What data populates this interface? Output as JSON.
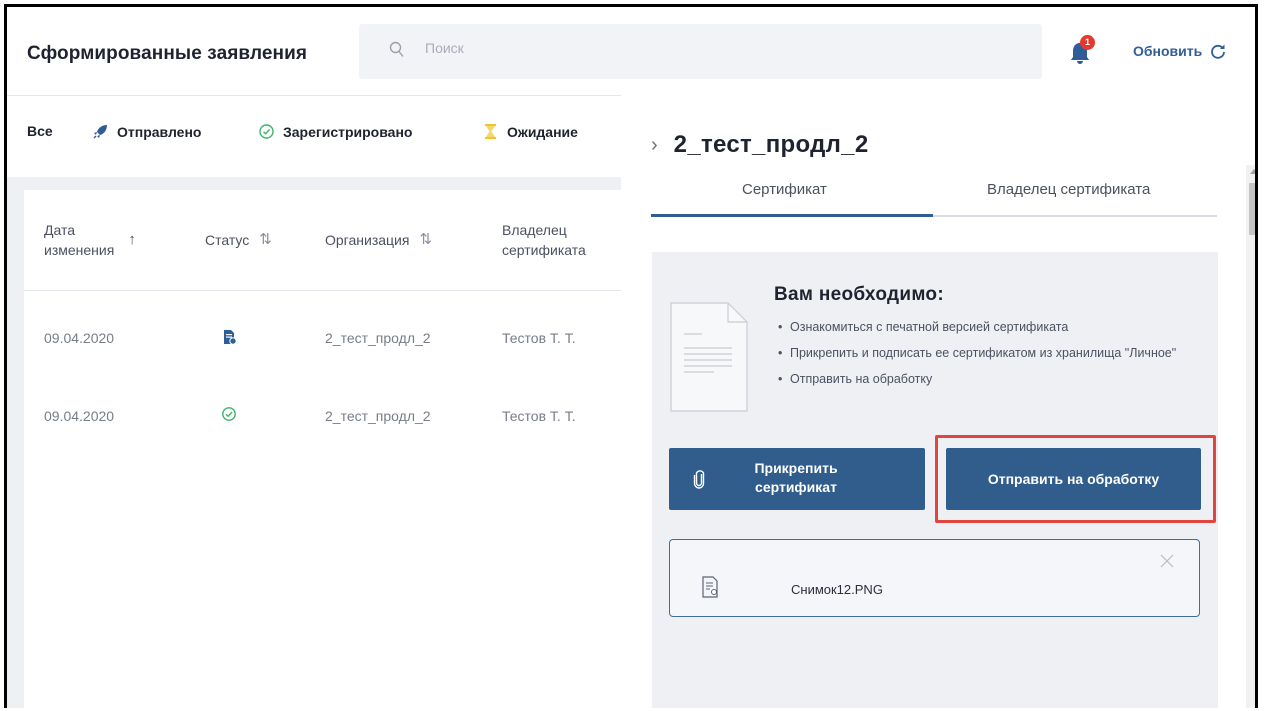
{
  "header": {
    "title": "Сформированные заявления",
    "search_placeholder": "Поиск",
    "notification_count": "1",
    "refresh_label": "Обновить"
  },
  "filters": {
    "all": "Все",
    "sent": "Отправлено",
    "registered": "Зарегистрировано",
    "waiting": "Ожидание"
  },
  "table": {
    "columns": {
      "date_line1": "Дата",
      "date_line2": "изменения",
      "status": "Статус",
      "organization": "Организация",
      "owner_line1": "Владелец",
      "owner_line2": "сертификата"
    },
    "rows": [
      {
        "date": "09.04.2020",
        "status": "sent",
        "organization": "2_тест_продл_2",
        "owner": "Тестов Т. Т."
      },
      {
        "date": "09.04.2020",
        "status": "registered",
        "organization": "2_тест_продл_2",
        "owner": "Тестов Т. Т."
      }
    ]
  },
  "detail": {
    "title": "2_тест_продл_2",
    "tabs": [
      "Сертификат",
      "Владелец сертификата"
    ],
    "active_tab": 0,
    "heading": "Вам необходимо:",
    "bullets": [
      "Ознакомиться с печатной версией сертификата",
      "Прикрепить и подписать ее сертификатом из хранилища \"Личное\"",
      "Отправить на обработку"
    ],
    "attach_button": "Прикрепить сертификат",
    "send_button": "Отправить на обработку",
    "file_name": "Снимок12.PNG"
  },
  "colors": {
    "primary": "#305d8c",
    "link": "#2f5e97",
    "highlight": "#e0463f",
    "badge": "#e23a2f",
    "waiting_icon": "#f2c230",
    "registered_icon": "#3fb36b"
  }
}
